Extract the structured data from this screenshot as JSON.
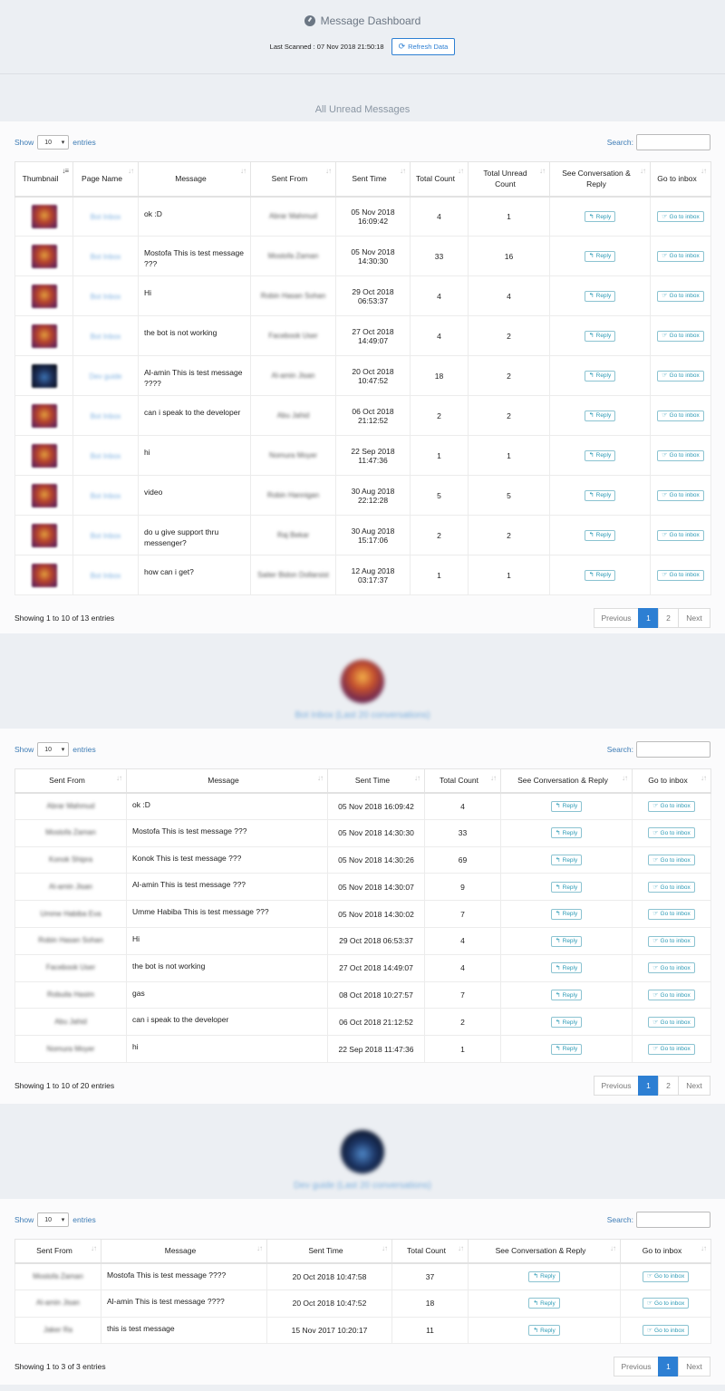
{
  "header": {
    "title": "Message Dashboard",
    "last_scanned": "Last Scanned : 07 Nov 2018 21:50:18",
    "refresh_label": "Refresh Data"
  },
  "controls": {
    "show_label": "Show",
    "entries_label": "entries",
    "length_value": "10",
    "search_label": "Search:"
  },
  "pager_labels": {
    "previous": "Previous",
    "next": "Next"
  },
  "buttons": {
    "reply": "Reply",
    "inbox": "Go to inbox"
  },
  "unread": {
    "title": "All Unread Messages",
    "columns": [
      "Thumbnail",
      "Page Name",
      "Message",
      "Sent From",
      "Sent Time",
      "Total Count",
      "Total Unread Count",
      "See Conversation & Reply",
      "Go to inbox"
    ],
    "rows": [
      {
        "page": "Bot Inbox",
        "message": "ok :D",
        "from": "Abrar Mahmud",
        "time": "05 Nov 2018 16:09:42",
        "total": "4",
        "unread": "1",
        "thumb": "warm"
      },
      {
        "page": "Bot Inbox",
        "message": "Mostofa This is test message ???",
        "from": "Mostofa Zaman",
        "time": "05 Nov 2018 14:30:30",
        "total": "33",
        "unread": "16",
        "thumb": "warm"
      },
      {
        "page": "Bot Inbox",
        "message": "Hi",
        "from": "Robin Hasan Sohan",
        "time": "29 Oct 2018 06:53:37",
        "total": "4",
        "unread": "4",
        "thumb": "warm"
      },
      {
        "page": "Bot Inbox",
        "message": "the bot is not working",
        "from": "Facebook User",
        "time": "27 Oct 2018 14:49:07",
        "total": "4",
        "unread": "2",
        "thumb": "warm"
      },
      {
        "page": "Dev guide",
        "message": "Al-amin This is test message ????",
        "from": "Al-amin Jisan",
        "time": "20 Oct 2018 10:47:52",
        "total": "18",
        "unread": "2",
        "thumb": "dark"
      },
      {
        "page": "Bot Inbox",
        "message": "can i speak to the developer",
        "from": "Abu Jahid",
        "time": "06 Oct 2018 21:12:52",
        "total": "2",
        "unread": "2",
        "thumb": "warm"
      },
      {
        "page": "Bot Inbox",
        "message": "hi",
        "from": "Nomura Moyer",
        "time": "22 Sep 2018 11:47:36",
        "total": "1",
        "unread": "1",
        "thumb": "warm"
      },
      {
        "page": "Bot Inbox",
        "message": "video",
        "from": "Robin Hannigan",
        "time": "30 Aug 2018 22:12:28",
        "total": "5",
        "unread": "5",
        "thumb": "warm"
      },
      {
        "page": "Bot Inbox",
        "message": "do u give support thru messenger?",
        "from": "Raj Bekar",
        "time": "30 Aug 2018 15:17:06",
        "total": "2",
        "unread": "2",
        "thumb": "warm"
      },
      {
        "page": "Bot Inbox",
        "message": "how can i get?",
        "from": "Saiter Bidon Dollarsist",
        "time": "12 Aug 2018 03:17:37",
        "total": "1",
        "unread": "1",
        "thumb": "warm"
      }
    ],
    "info": "Showing 1 to 10 of 13 entries",
    "pages": [
      "1",
      "2"
    ]
  },
  "page1": {
    "caption": "Bot Inbox (Last 20 conversations)",
    "columns": [
      "Sent From",
      "Message",
      "Sent Time",
      "Total Count",
      "See Conversation & Reply",
      "Go to inbox"
    ],
    "rows": [
      {
        "from": "Abrar Mahmud",
        "message": "ok :D",
        "time": "05 Nov 2018 16:09:42",
        "total": "4"
      },
      {
        "from": "Mostofa Zaman",
        "message": "Mostofa This is test message ???",
        "time": "05 Nov 2018 14:30:30",
        "total": "33"
      },
      {
        "from": "Konok Shipra",
        "message": "Konok This is test message ???",
        "time": "05 Nov 2018 14:30:26",
        "total": "69"
      },
      {
        "from": "Al-amin Jisan",
        "message": "Al-amin This is test message ???",
        "time": "05 Nov 2018 14:30:07",
        "total": "9"
      },
      {
        "from": "Umme Habiba Eva",
        "message": "Umme Habiba This is test message ???",
        "time": "05 Nov 2018 14:30:02",
        "total": "7"
      },
      {
        "from": "Robin Hasan Sohan",
        "message": "Hi",
        "time": "29 Oct 2018 06:53:37",
        "total": "4"
      },
      {
        "from": "Facebook User",
        "message": "the bot is not working",
        "time": "27 Oct 2018 14:49:07",
        "total": "4"
      },
      {
        "from": "Robuila Hasim",
        "message": "gas",
        "time": "08 Oct 2018 10:27:57",
        "total": "7"
      },
      {
        "from": "Abu Jahid",
        "message": "can i speak to the developer",
        "time": "06 Oct 2018 21:12:52",
        "total": "2"
      },
      {
        "from": "Nomura Moyer",
        "message": "hi",
        "time": "22 Sep 2018 11:47:36",
        "total": "1"
      }
    ],
    "info": "Showing 1 to 10 of 20 entries",
    "pages": [
      "1",
      "2"
    ]
  },
  "page2": {
    "caption": "Dev guide (Last 20 conversations)",
    "columns": [
      "Sent From",
      "Message",
      "Sent Time",
      "Total Count",
      "See Conversation & Reply",
      "Go to inbox"
    ],
    "rows": [
      {
        "from": "Mostofa Zaman",
        "message": "Mostofa This is test message ????",
        "time": "20 Oct 2018 10:47:58",
        "total": "37"
      },
      {
        "from": "Al-amin Jisan",
        "message": "Al-amin This is test message ????",
        "time": "20 Oct 2018 10:47:52",
        "total": "18"
      },
      {
        "from": "Jaker Ra",
        "message": "this is test message",
        "time": "15 Nov 2017 10:20:17",
        "total": "11"
      }
    ],
    "info": "Showing 1 to 3 of 3 entries",
    "pages": [
      "1"
    ]
  },
  "colors": {
    "accent": "#2d7fd3",
    "reply_teal": "#2d9bb6",
    "link_blue": "#3c7bb5"
  }
}
